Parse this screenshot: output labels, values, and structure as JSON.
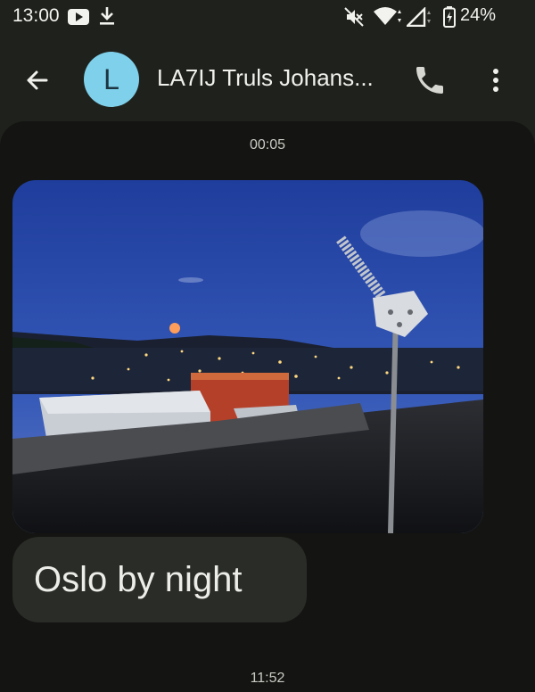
{
  "status_bar": {
    "time": "13:00",
    "battery": "24%",
    "icons": [
      "youtube-icon",
      "download-icon",
      "mute-icon",
      "wifi-icon",
      "signal-icon",
      "battery-icon"
    ]
  },
  "app_bar": {
    "avatar_letter": "L",
    "contact_name": "LA7IJ Truls Johans...",
    "icons": [
      "back-arrow-icon",
      "phone-icon",
      "more-vert-icon"
    ],
    "avatar_color": "#7fd0ea"
  },
  "conversation": {
    "timestamp_top": "00:05",
    "image_caption_text": "Oslo by night",
    "timestamp_bottom": "11:52"
  },
  "colors": {
    "background": "#1f211d",
    "conversation_bg": "#141512",
    "bubble_bg": "#2a2c28"
  }
}
